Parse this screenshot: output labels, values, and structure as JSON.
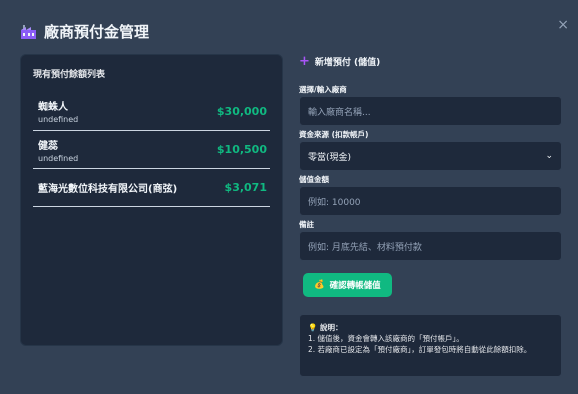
{
  "modal": {
    "title": "廠商預付金管理",
    "close_glyph": "×"
  },
  "balance_list": {
    "heading": "現有預付餘額列表",
    "items": [
      {
        "name": "蜘蛛人",
        "sub": "undefined",
        "amount": "$30,000"
      },
      {
        "name": "健蕊",
        "sub": "undefined",
        "amount": "$10,500"
      },
      {
        "name": "藍海光數位科技有限公司(商弦)",
        "sub": "",
        "amount": "$3,071"
      }
    ]
  },
  "form": {
    "heading": "新增預付 (儲值)",
    "vendor": {
      "label": "選擇/輸入廠商",
      "placeholder": "輸入廠商名稱..."
    },
    "source": {
      "label": "資金來源 (扣款帳戶)",
      "value": "零當(現金)"
    },
    "amount": {
      "label": "儲值金額",
      "placeholder": "例如: 10000"
    },
    "note": {
      "label": "備註",
      "placeholder": "例如: 月底先結、材料預付款"
    },
    "submit_label": "確認轉帳儲值",
    "submit_icon": "💰"
  },
  "notes": {
    "title": "💡 說明：",
    "lines": [
      "1. 儲值後，資金會轉入該廠商的「預付帳戶」。",
      "2. 若廠商已設定為「預付廠商」，訂單發包時將自動從此餘額扣除。"
    ]
  },
  "colors": {
    "accent_green": "#10b981",
    "accent_purple": "#a855f7",
    "background": "#334155",
    "panel": "#1e293b"
  },
  "icons": {
    "title": "factory-icon",
    "close": "close-icon",
    "heading": "plus-icon",
    "submit": "money-bag-icon",
    "note": "lightbulb-icon",
    "select": "chevron-down-icon"
  }
}
